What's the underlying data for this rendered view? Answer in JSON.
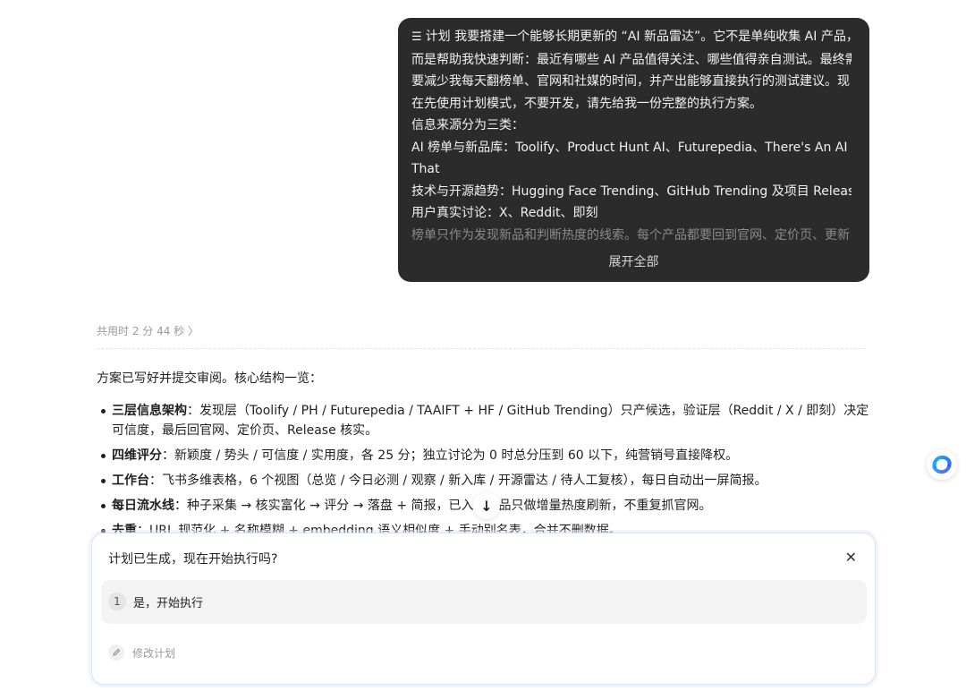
{
  "user_message": {
    "lines": [
      "计划 我要搭建一个能够长期更新的 “AI 新品雷达”。它不是单纯收集 AI 产品，",
      "而是帮助我快速判断：最近有哪些 AI 产品值得关注、哪些值得亲自测试。最终需",
      "要减少我每天翻榜单、官网和社媒的时间，并产出能够直接执行的测试建议。现",
      "在先使用计划模式，不要开发，请先给我一份完整的执行方案。",
      "信息来源分为三类：",
      "AI 榜单与新品库：Toolify、Product Hunt AI、Futurepedia、There's An AI For",
      "That",
      "技术与开源趋势：Hugging Face Trending、GitHub Trending 及项目 Releases",
      "用户真实讨论：X、Reddit、即刻"
    ],
    "faded_line": "榜单只作为发现新品和判断热度的线索。每个产品都要回到官网、定价页、更新",
    "expand_label": "展开全部"
  },
  "timing": "共用时 2 分 44 秒 〉",
  "answer": {
    "intro": "方案已写好并提交审阅。核心结构一览：",
    "bullets": [
      {
        "title": "三层信息架构",
        "text": "：发现层（Toolify / PH / Futurepedia / TAAIFT + HF / GitHub Trending）只产候选，验证层（Reddit / X / 即刻）决定可信度，最后回官网、定价页、Release 核实。"
      },
      {
        "title": "四维评分",
        "text": "：新颖度 / 势头 / 可信度 / 实用度，各 25 分；独立讨论为 0 时总分压到 60 以下，纯营销号直接降权。"
      },
      {
        "title": "工作台",
        "text": "：飞书多维表格，6 个视图（总览 / 今日必测 / 观察 / 新入库 / 开源雷达 / 待人工复核），每日自动出一屏简报。"
      },
      {
        "title": "每日流水线",
        "text": "：种子采集 → 核实富化 → 评分 → 落盘 + 简报，已入库产品只做增量热度刷新，不重复抓官网。"
      },
      {
        "title": "去重",
        "text": "：URL 规范化 + 名称模糊 + embedding 语义相似度 + 手动别名表，合并不删数据。"
      }
    ]
  },
  "confirm": {
    "title": "计划已生成，现在开始执行吗?",
    "option_number": "1",
    "option_label": "是，开始执行",
    "edit_label": "修改计划"
  },
  "icons": {
    "plan": "plan-list-icon",
    "close": "close-icon",
    "scroll": "arrow-down-icon",
    "edit": "pencil-icon",
    "side": "assistant-logo-icon"
  },
  "colors": {
    "bubble_bg": "#2b2b2b",
    "panel_border": "#d9e4f5",
    "logo_blue": "#2a7cf0"
  }
}
